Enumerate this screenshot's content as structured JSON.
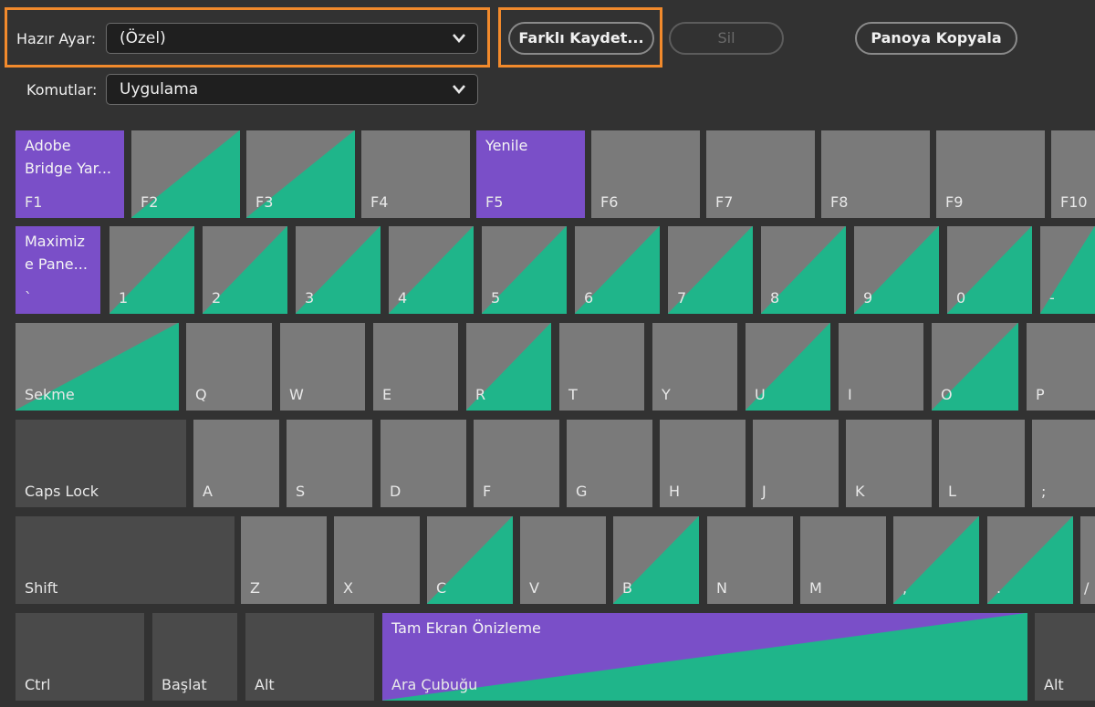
{
  "toolbar": {
    "preset_label": "Hazır Ayar:",
    "preset_value": "(Özel)",
    "commands_label": "Komutlar:",
    "commands_value": "Uygulama",
    "save_as_label": "Farklı Kaydet...",
    "delete_label": "Sil",
    "copy_clipboard_label": "Panoya Kopyala"
  },
  "colors": {
    "accent_highlight": "#f28a2c",
    "command_key": "#7a4fc8",
    "modifier_shortcut": "#1fb58a",
    "key_default": "#7a7a7a",
    "key_modifier": "#4a4a4a"
  },
  "keyboard": {
    "row1": [
      {
        "key": "F1",
        "command": "Adobe\nBridge Yar..."
      },
      {
        "key": "F2"
      },
      {
        "key": "F3"
      },
      {
        "key": "F4"
      },
      {
        "key": "F5",
        "command": "Yenile"
      },
      {
        "key": "F6"
      },
      {
        "key": "F7"
      },
      {
        "key": "F8"
      },
      {
        "key": "F9"
      },
      {
        "key": "F10"
      }
    ],
    "row2": [
      {
        "key": "`",
        "command": "Maximiz\ne Pane..."
      },
      {
        "key": "1"
      },
      {
        "key": "2"
      },
      {
        "key": "3"
      },
      {
        "key": "4"
      },
      {
        "key": "5"
      },
      {
        "key": "6"
      },
      {
        "key": "7"
      },
      {
        "key": "8"
      },
      {
        "key": "9"
      },
      {
        "key": "0"
      },
      {
        "key": "-"
      }
    ],
    "row3": [
      {
        "key": "Sekme"
      },
      {
        "key": "Q"
      },
      {
        "key": "W"
      },
      {
        "key": "E"
      },
      {
        "key": "R"
      },
      {
        "key": "T"
      },
      {
        "key": "Y"
      },
      {
        "key": "U"
      },
      {
        "key": "I"
      },
      {
        "key": "O"
      },
      {
        "key": "P"
      }
    ],
    "row4": [
      {
        "key": "Caps Lock"
      },
      {
        "key": "A"
      },
      {
        "key": "S"
      },
      {
        "key": "D"
      },
      {
        "key": "F"
      },
      {
        "key": "G"
      },
      {
        "key": "H"
      },
      {
        "key": "J"
      },
      {
        "key": "K"
      },
      {
        "key": "L"
      },
      {
        "key": ";"
      }
    ],
    "row5": [
      {
        "key": "Shift"
      },
      {
        "key": "Z"
      },
      {
        "key": "X"
      },
      {
        "key": "C"
      },
      {
        "key": "V"
      },
      {
        "key": "B"
      },
      {
        "key": "N"
      },
      {
        "key": "M"
      },
      {
        "key": ","
      },
      {
        "key": "."
      },
      {
        "key": "/"
      }
    ],
    "row6": [
      {
        "key": "Ctrl"
      },
      {
        "key": "Başlat"
      },
      {
        "key": "Alt"
      },
      {
        "key": "Ara Çubuğu",
        "command": "Tam Ekran Önizleme"
      },
      {
        "key": "Alt"
      }
    ]
  }
}
